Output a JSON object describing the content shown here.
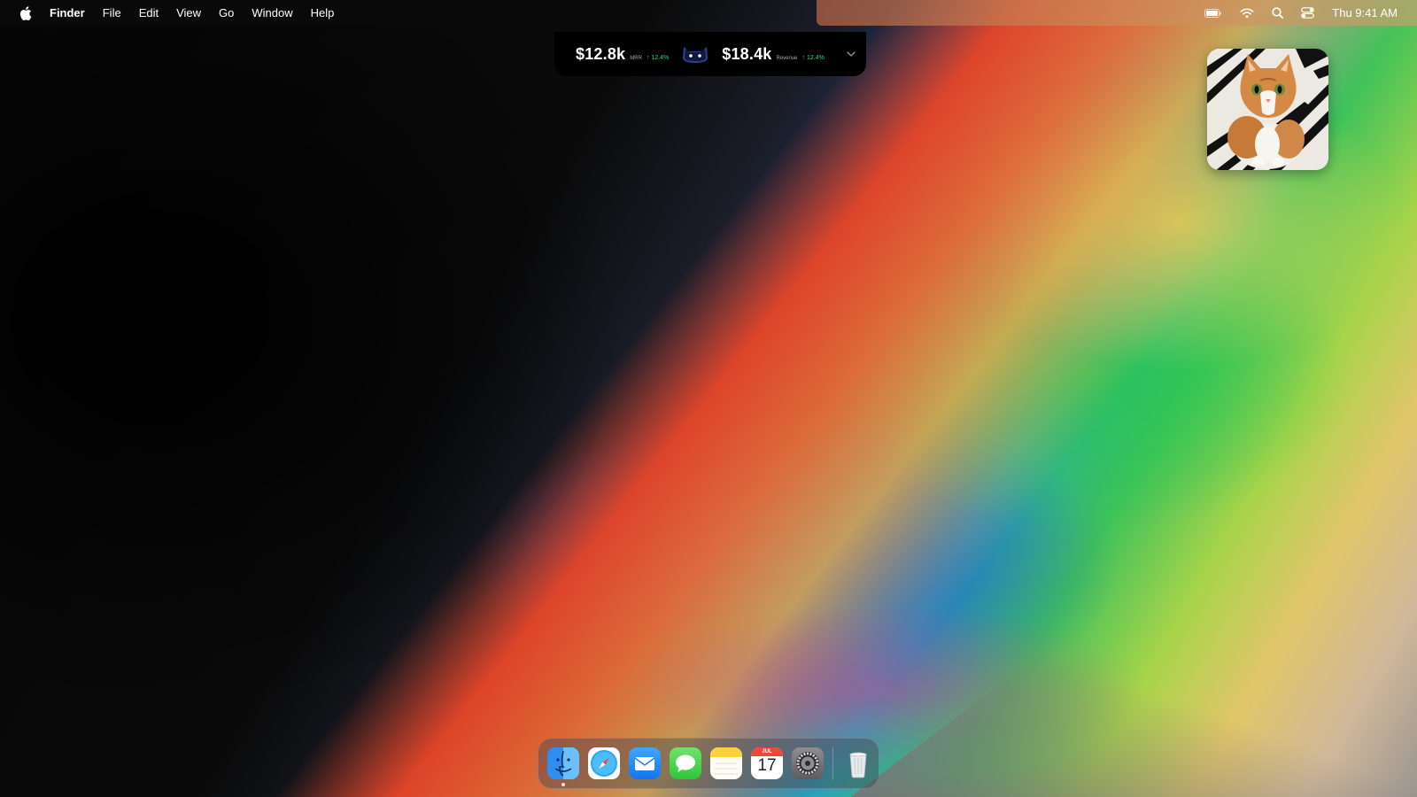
{
  "menubar": {
    "apple_icon": "apple-logo-icon",
    "app_name": "Finder",
    "items": [
      "File",
      "Edit",
      "View",
      "Go",
      "Window",
      "Help"
    ],
    "status_icons": [
      "battery-icon",
      "wifi-icon",
      "spotlight-search-icon",
      "control-center-icon"
    ],
    "clock": "Thu 9:41 AM"
  },
  "stats_widget": {
    "mrr": {
      "value": "$12.8k",
      "label": "MRR",
      "change": "↑ 12.4%"
    },
    "revenue": {
      "value": "$18.4k",
      "label": "Revenue",
      "change": "↑ 12.4%"
    },
    "mascot_icon": "cat-mascot-icon",
    "chevron_icon": "chevron-down-icon",
    "positive_color": "#37d67a"
  },
  "photo_widget": {
    "subject": "orange-kitten-photo"
  },
  "dock": {
    "apps": [
      "Finder",
      "Safari",
      "Mail",
      "Messages",
      "Notes",
      "Calendar",
      "System Settings",
      "Trash"
    ],
    "calendar": {
      "month": "JUL",
      "day": "17"
    }
  }
}
